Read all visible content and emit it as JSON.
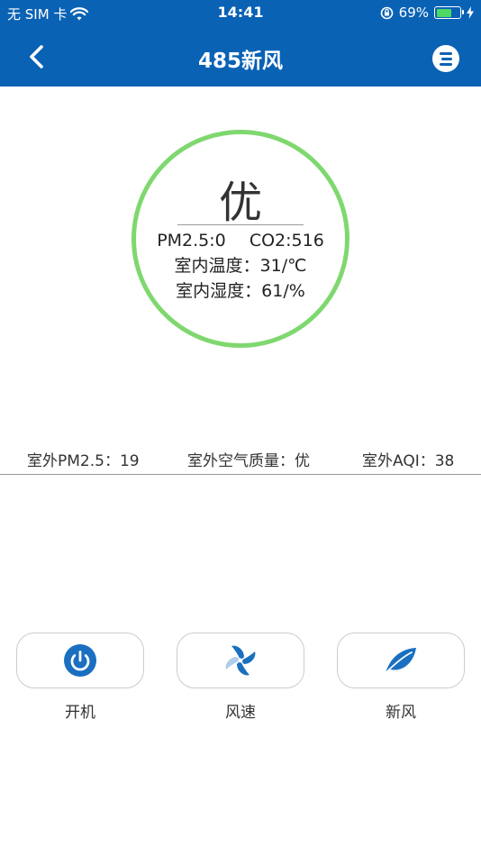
{
  "status_bar": {
    "carrier": "无 SIM 卡",
    "time": "14:41",
    "battery_percent": "69%",
    "battery_level": 0.69,
    "icons": [
      "wifi-icon",
      "orientation-lock-icon",
      "battery-icon",
      "charging-icon"
    ]
  },
  "nav": {
    "title": "485新风",
    "back_icon": "chevron-left-icon",
    "menu_icon": "list-menu-icon"
  },
  "indoor": {
    "quality": "优",
    "pm25": "PM2.5:0",
    "co2": "CO2:516",
    "temperature": "室内温度：31/℃",
    "humidity": "室内湿度：61/%",
    "ring_color": "#7fd86f"
  },
  "outdoor": {
    "pm25": "室外PM2.5：19",
    "air_quality": "室外空气质量：优",
    "aqi": "室外AQI：38"
  },
  "controls": [
    {
      "label": "开机",
      "icon": "power-icon"
    },
    {
      "label": "风速",
      "icon": "fan-icon"
    },
    {
      "label": "新风",
      "icon": "leaf-icon"
    }
  ],
  "colors": {
    "brand": "#0a62b5",
    "accent": "#1a6fc0"
  }
}
